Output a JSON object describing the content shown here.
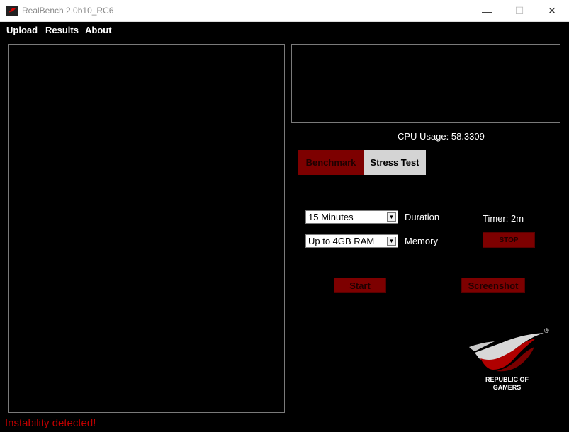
{
  "window": {
    "title": "RealBench 2.0b10_RC6"
  },
  "menu": {
    "items": [
      "Upload",
      "Results",
      "About"
    ]
  },
  "cpu": {
    "usage_text": "CPU Usage: 58.3309"
  },
  "tabs": {
    "benchmark": "Benchmark",
    "stress": "Stress Test"
  },
  "controls": {
    "duration_value": "15 Minutes",
    "duration_label": "Duration",
    "memory_value": "Up to 4GB RAM",
    "memory_label": "Memory",
    "timer": "Timer: 2m",
    "stop": "STOP",
    "start": "Start",
    "screenshot": "Screenshot"
  },
  "logo": {
    "line1": "REPUBLIC OF",
    "line2": "GAMERS",
    "registered": "®"
  },
  "status": {
    "message": "Instability detected!"
  },
  "colors": {
    "accent": "#7d0000",
    "status_text": "#c00000"
  }
}
